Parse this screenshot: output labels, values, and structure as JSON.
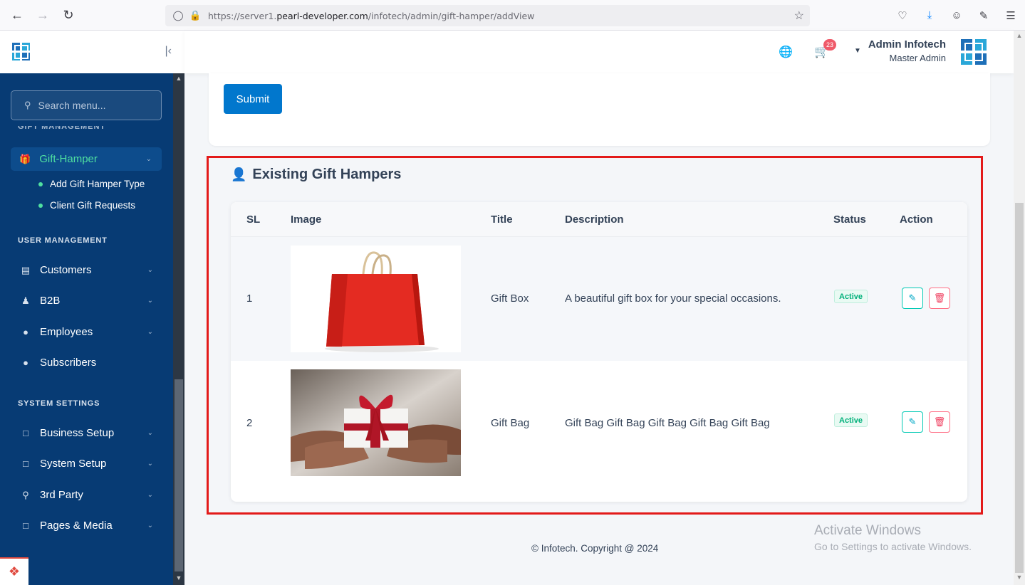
{
  "browser": {
    "url_prefix": "https://server1.",
    "url_host": "pearl-developer.com",
    "url_path": "/infotech/admin/gift-hamper/addView"
  },
  "sidebar": {
    "search_placeholder": "Search menu...",
    "cut_heading": "GIFT MANAGEMENT",
    "active_item": "Gift-Hamper",
    "sub_items": [
      "Add Gift Hamper Type",
      "Client Gift Requests"
    ],
    "sections": [
      {
        "title": "USER MANAGEMENT",
        "items": [
          {
            "label": "Customers",
            "icon": "wallet-icon",
            "has_chevron": true
          },
          {
            "label": "B2B",
            "icon": "users-icon",
            "has_chevron": true
          },
          {
            "label": "Employees",
            "icon": "user-icon",
            "has_chevron": true
          },
          {
            "label": "Subscribers",
            "icon": "user-icon",
            "has_chevron": false
          }
        ]
      },
      {
        "title": "SYSTEM SETTINGS",
        "items": [
          {
            "label": "Business Setup",
            "icon": "document-icon",
            "has_chevron": true
          },
          {
            "label": "System Setup",
            "icon": "document-icon",
            "has_chevron": true
          },
          {
            "label": "3rd Party",
            "icon": "key-icon",
            "has_chevron": true
          },
          {
            "label": "Pages & Media",
            "icon": "document-icon",
            "has_chevron": true
          }
        ]
      }
    ]
  },
  "header": {
    "cart_count": "23",
    "admin_name": "Admin Infotech",
    "admin_role": "Master Admin"
  },
  "form": {
    "submit_label": "Submit"
  },
  "list": {
    "title": "Existing Gift Hampers",
    "columns": [
      "SL",
      "Image",
      "Title",
      "Description",
      "Status",
      "Action"
    ],
    "rows": [
      {
        "sl": "1",
        "image": "red-shopping-bag",
        "title": "Gift Box",
        "description": "A beautiful gift box for your special occasions.",
        "status": "Active"
      },
      {
        "sl": "2",
        "image": "hands-holding-gift",
        "title": "Gift Bag",
        "description": "Gift Bag Gift Bag Gift Bag Gift Bag Gift Bag",
        "status": "Active"
      }
    ]
  },
  "footer": {
    "copyright": "© Infotech. Copyright @ 2024"
  },
  "watermark": {
    "title": "Activate Windows",
    "subtitle": "Go to Settings to activate Windows."
  },
  "colors": {
    "sidebar_bg": "#073b74",
    "accent_green": "#4fe0a0",
    "primary_button": "#0177cd",
    "highlight_border": "#e31a1a",
    "status_active": "#00b07a"
  }
}
